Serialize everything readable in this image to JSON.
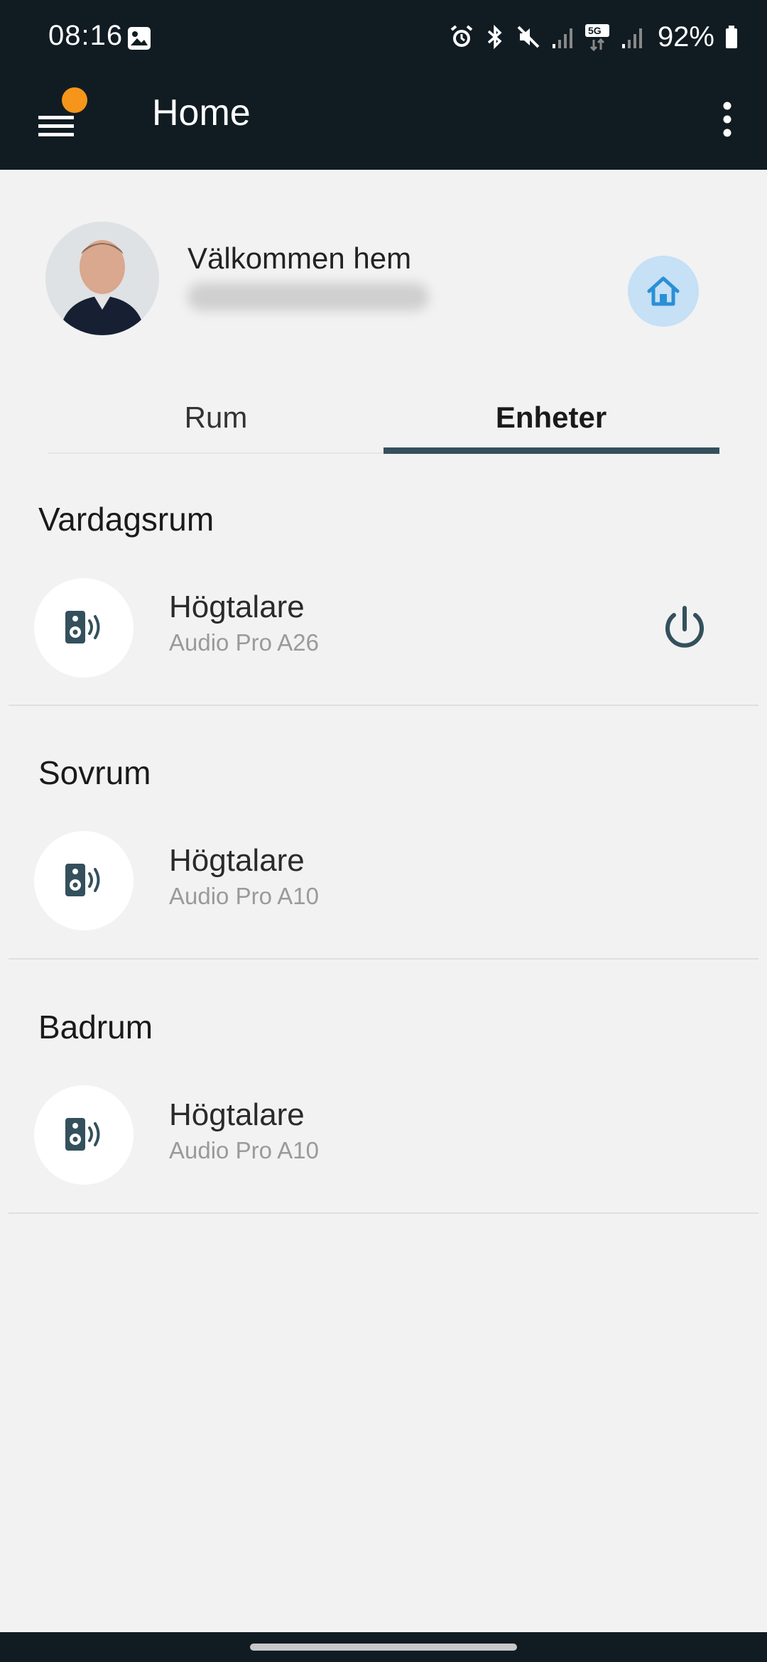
{
  "status_bar": {
    "time": "08:16",
    "icons": [
      "gallery-icon",
      "alarm-icon",
      "bluetooth-icon",
      "mute-icon",
      "signal-icon",
      "5g-icon",
      "signal-icon",
      "battery-icon"
    ],
    "network": "5G",
    "battery": "92%"
  },
  "app_bar": {
    "title": "Home",
    "menu_icon": "hamburger-menu-icon",
    "notification_dot_color": "#f5951a",
    "more_icon": "more-vert-icon"
  },
  "profile": {
    "welcome": "Välkommen hem",
    "home_icon": "home-icon"
  },
  "tabs": [
    {
      "label": "Rum",
      "selected": false
    },
    {
      "label": "Enheter",
      "selected": true
    }
  ],
  "rooms": [
    {
      "title": "Vardagsrum",
      "device": {
        "name": "Högtalare",
        "model": "Audio Pro A26",
        "icon": "speaker-icon",
        "power_button": true
      }
    },
    {
      "title": "Sovrum",
      "device": {
        "name": "Högtalare",
        "model": "Audio Pro A10",
        "icon": "speaker-icon",
        "power_button": false
      }
    },
    {
      "title": "Badrum",
      "device": {
        "name": "Högtalare",
        "model": "Audio Pro A10",
        "icon": "speaker-icon",
        "power_button": false
      }
    }
  ],
  "colors": {
    "app_bar": "#111c22",
    "background": "#f2f2f2",
    "accent": "#34505c",
    "home_button_bg": "#c6e0f5",
    "home_icon": "#2b8fd6"
  }
}
